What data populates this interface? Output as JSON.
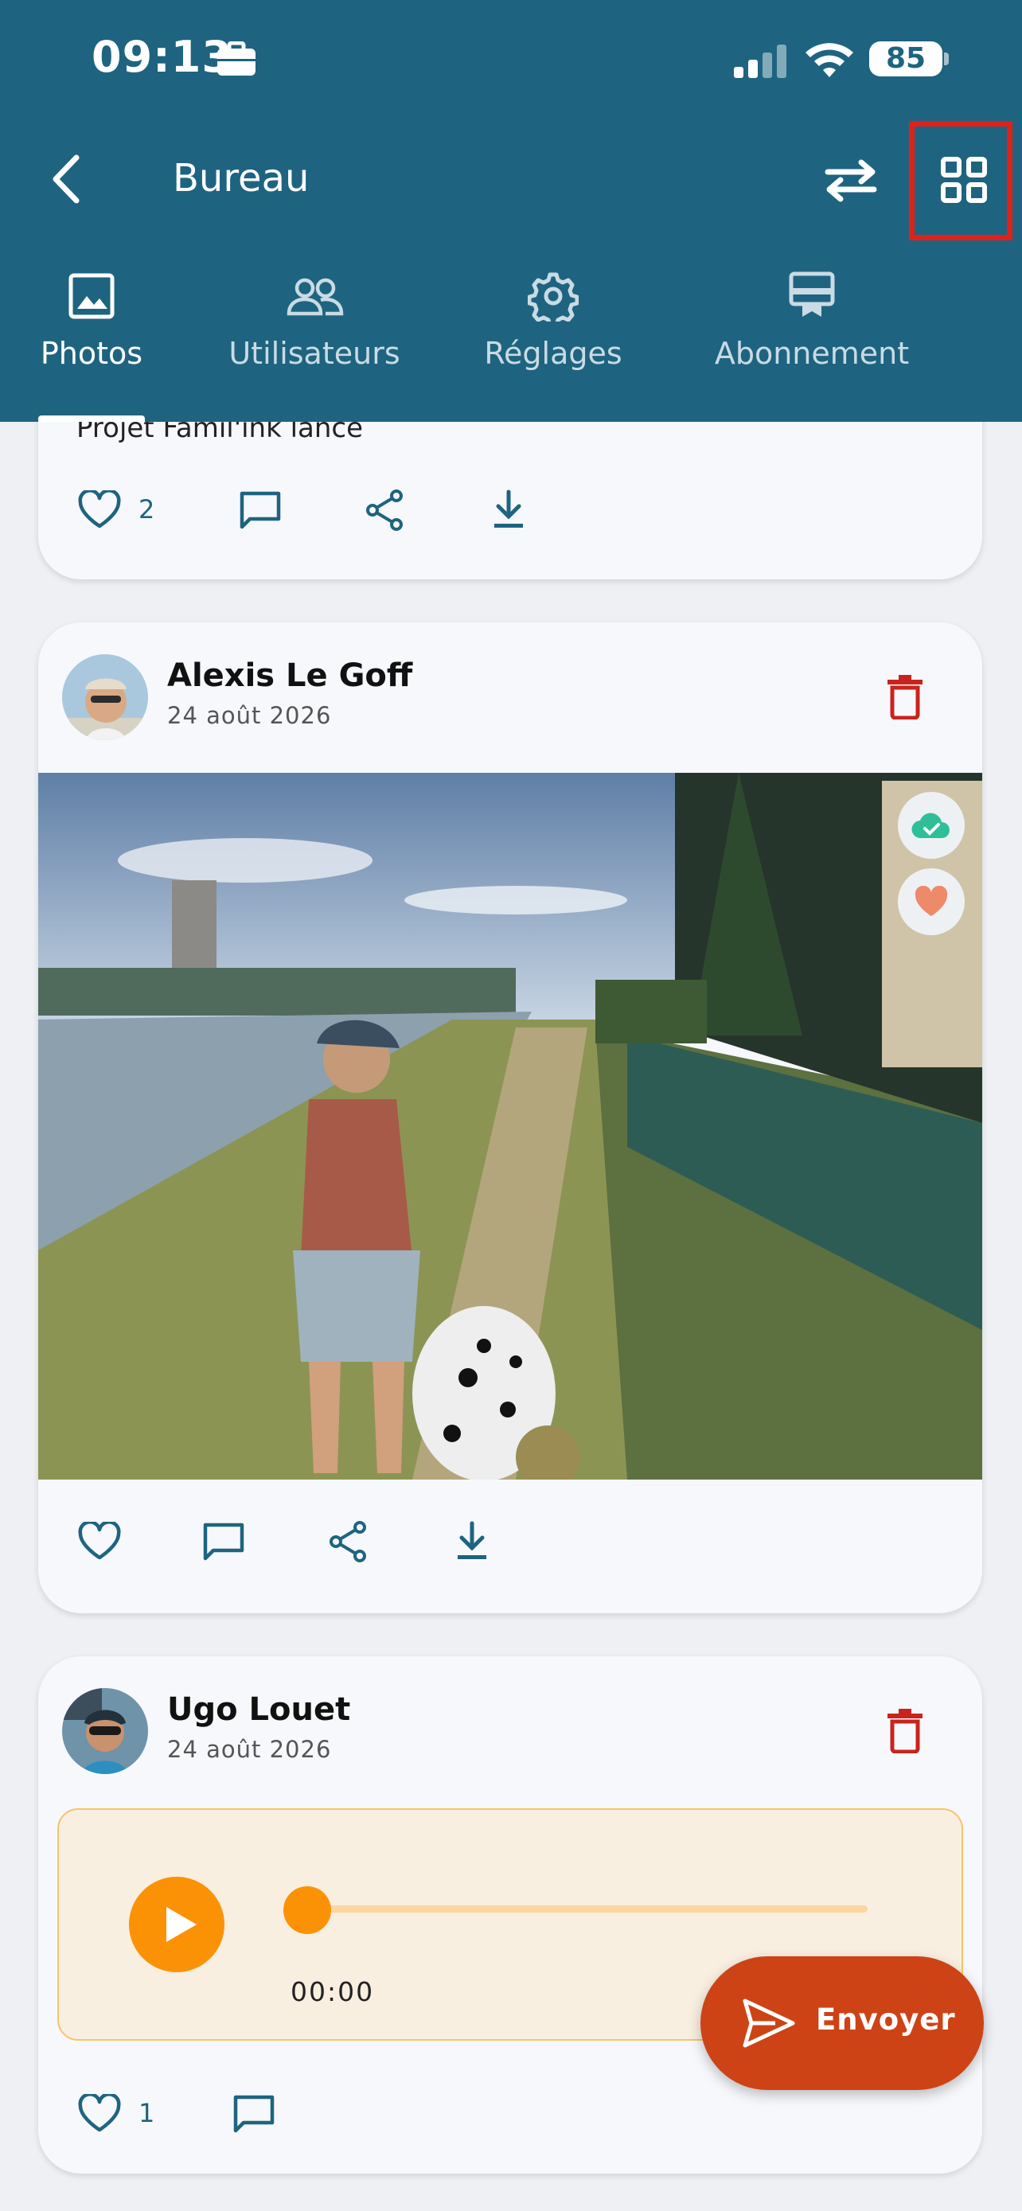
{
  "status_bar": {
    "time": "09:13",
    "battery": "85"
  },
  "top_bar": {
    "title": "Bureau"
  },
  "tabs": [
    {
      "label": "Photos",
      "icon": "image-icon",
      "active": true
    },
    {
      "label": "Utilisateurs",
      "icon": "users-icon",
      "active": false
    },
    {
      "label": "Réglages",
      "icon": "gear-icon",
      "active": false
    },
    {
      "label": "Abonnement",
      "icon": "subscription-icon",
      "active": false
    }
  ],
  "feed": {
    "partial_post": {
      "caption": "Projet Famil'ink lancé",
      "likes": "2"
    },
    "posts": [
      {
        "author": "Alexis Le Goff",
        "date": "24 août 2026",
        "type": "photo"
      },
      {
        "author": "Ugo Louet",
        "date": "24 août 2026",
        "type": "audio",
        "audio_time": "00:00",
        "likes": "1"
      }
    ]
  },
  "fab": {
    "label": "Envoyer"
  },
  "colors": {
    "header": "#1e6480",
    "accent_orange": "#fb9206",
    "send_button": "#cd4316",
    "delete_red": "#c8241d"
  }
}
